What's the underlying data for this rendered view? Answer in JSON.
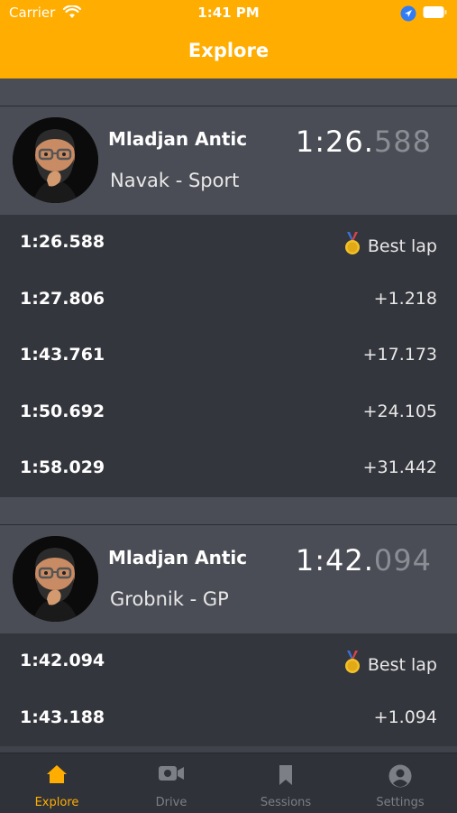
{
  "status_bar": {
    "carrier": "Carrier",
    "time": "1:41 PM"
  },
  "header": {
    "title": "Explore"
  },
  "sessions": [
    {
      "driver": "Mladjan Antic",
      "track": "Navak - Sport",
      "best_main": "1:26.",
      "best_ms": "588",
      "laps": [
        {
          "time": "1:26.588",
          "delta": "Best lap",
          "best": true
        },
        {
          "time": "1:27.806",
          "delta": "+1.218"
        },
        {
          "time": "1:43.761",
          "delta": "+17.173"
        },
        {
          "time": "1:50.692",
          "delta": "+24.105"
        },
        {
          "time": "1:58.029",
          "delta": "+31.442"
        }
      ]
    },
    {
      "driver": "Mladjan Antic",
      "track": "Grobnik - GP",
      "best_main": "1:42.",
      "best_ms": "094",
      "laps": [
        {
          "time": "1:42.094",
          "delta": "Best lap",
          "best": true
        },
        {
          "time": "1:43.188",
          "delta": "+1.094"
        }
      ]
    }
  ],
  "tabs": [
    {
      "label": "Explore",
      "icon": "home-icon",
      "active": true
    },
    {
      "label": "Drive",
      "icon": "video-camera-icon"
    },
    {
      "label": "Sessions",
      "icon": "bookmark-icon"
    },
    {
      "label": "Settings",
      "icon": "person-icon"
    }
  ],
  "colors": {
    "accent": "#ffad00",
    "background": "#3f424a",
    "row": "#34363d"
  }
}
